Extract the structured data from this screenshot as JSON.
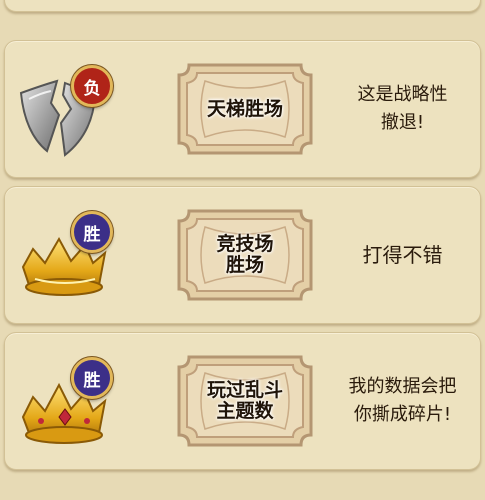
{
  "records": [
    {
      "result_badge": "负",
      "result_type": "lose",
      "emblem_icon": "broken-shield-icon",
      "achievement": "天梯胜场",
      "comment": "这是战略性\n撤退!"
    },
    {
      "result_badge": "胜",
      "result_type": "win",
      "emblem_icon": "gold-crown-icon",
      "achievement": "竞技场\n胜场",
      "comment": "打得不错"
    },
    {
      "result_badge": "胜",
      "result_type": "win",
      "emblem_icon": "gold-crown-icon",
      "achievement": "玩过乱斗\n主题数",
      "comment": "我的数据会把\n你撕成碎片!"
    }
  ],
  "colors": {
    "background": "#e7dab5",
    "card": "#ede2bf",
    "lose_badge": "#b02418",
    "win_badge": "#3c2f88",
    "gold": "#e2b85a"
  }
}
